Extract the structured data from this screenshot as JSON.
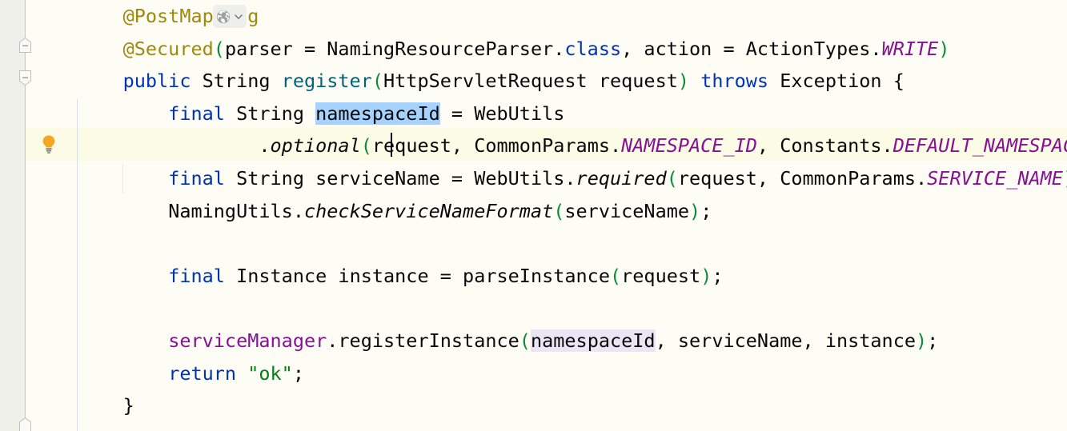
{
  "editor": {
    "language": "java",
    "theme": "IntelliJ Light",
    "colors": {
      "background": "#fdfdf6",
      "gutter_background": "#f0f0ea",
      "caret_row": "#fcfbe6",
      "selection": "#a6d2ff",
      "identifier_usage": "#eae6f5",
      "keyword": "#0033b3",
      "annotation": "#9e880d",
      "static_field": "#871094",
      "field": "#871094",
      "method_declaration": "#00627a",
      "string": "#067d17",
      "parentheses": "#0b8c3b",
      "default_text": "#080808",
      "caret": "#000000",
      "indent_guide": "#d7e0e8",
      "fold_line": "#c9c9c4",
      "bulb_accent": "#f5a623"
    },
    "gutter": {
      "icons": [
        {
          "name": "intention-bulb-icon",
          "label": "Show Context Actions",
          "line": 4
        },
        {
          "name": "fold-marker-collapsed-icon",
          "label": "Collapse annotation",
          "line": 2
        },
        {
          "name": "fold-marker-expanded-icon",
          "label": "Collapse method body",
          "line": 3
        },
        {
          "name": "fold-marker-end-icon",
          "label": "Method body end",
          "line": 13
        }
      ]
    },
    "inlay_hint": {
      "name": "url-mapping-inlay",
      "globe_icon": "globe-icon",
      "chevron_icon": "chevron-down-icon",
      "tooltip": "Open in browser / URL mappings"
    },
    "caret": {
      "line": 4,
      "visible": true
    },
    "selection": {
      "text": "namespaceId",
      "line": 4
    },
    "usage_highlight": {
      "text": "namespaceId",
      "line": 11
    },
    "lines": [
      {
        "n": 1,
        "indent": 4,
        "tokens": [
          {
            "t": "@PostMapping",
            "c": "anno"
          }
        ]
      },
      {
        "n": 2,
        "indent": 4,
        "tokens": [
          {
            "t": "@Secured",
            "c": "anno"
          },
          {
            "t": "(",
            "c": "paren"
          },
          {
            "t": "parser = NamingResourceParser.",
            "c": "ident"
          },
          {
            "t": "class",
            "c": "kw"
          },
          {
            "t": ", action = ActionTypes.",
            "c": "ident"
          },
          {
            "t": "WRITE",
            "c": "sfield"
          },
          {
            "t": ")",
            "c": "paren"
          }
        ]
      },
      {
        "n": 3,
        "indent": 4,
        "tokens": [
          {
            "t": "public",
            "c": "kw"
          },
          {
            "t": " String ",
            "c": "ident"
          },
          {
            "t": "register",
            "c": "method"
          },
          {
            "t": "(",
            "c": "paren"
          },
          {
            "t": "HttpServletRequest request",
            "c": "ident"
          },
          {
            "t": ")",
            "c": "paren"
          },
          {
            "t": " ",
            "c": "ident"
          },
          {
            "t": "throws",
            "c": "kw"
          },
          {
            "t": " Exception {",
            "c": "ident"
          }
        ]
      },
      {
        "n": 4,
        "indent": 8,
        "tokens": [
          {
            "t": "final",
            "c": "kw"
          },
          {
            "t": " String ",
            "c": "ident"
          },
          {
            "t": "namespaceId",
            "c": "ident",
            "sel": true
          },
          {
            "t": " = WebUtils",
            "c": "ident"
          }
        ]
      },
      {
        "n": 5,
        "indent": 16,
        "tokens": [
          {
            "t": ".",
            "c": "punc"
          },
          {
            "t": "optional",
            "c": "smethod"
          },
          {
            "t": "(",
            "c": "paren"
          },
          {
            "t": "request, CommonParams.",
            "c": "ident"
          },
          {
            "t": "NAMESPACE_ID",
            "c": "sfield"
          },
          {
            "t": ", Constants.",
            "c": "ident"
          },
          {
            "t": "DEFAULT_NAMESPACE_ID",
            "c": "sfield"
          },
          {
            "t": ")",
            "c": "paren"
          },
          {
            "t": ";",
            "c": "punc"
          }
        ]
      },
      {
        "n": 6,
        "indent": 8,
        "tokens": [
          {
            "t": "final",
            "c": "kw"
          },
          {
            "t": " String serviceName = WebUtils.",
            "c": "ident"
          },
          {
            "t": "required",
            "c": "smethod"
          },
          {
            "t": "(",
            "c": "paren"
          },
          {
            "t": "request, CommonParams.",
            "c": "ident"
          },
          {
            "t": "SERVICE_NAME",
            "c": "sfield"
          },
          {
            "t": ")",
            "c": "paren"
          },
          {
            "t": ";",
            "c": "punc"
          }
        ]
      },
      {
        "n": 7,
        "indent": 8,
        "tokens": [
          {
            "t": "NamingUtils.",
            "c": "ident"
          },
          {
            "t": "checkServiceNameFormat",
            "c": "smethod"
          },
          {
            "t": "(",
            "c": "paren"
          },
          {
            "t": "serviceName",
            "c": "ident"
          },
          {
            "t": ")",
            "c": "paren"
          },
          {
            "t": ";",
            "c": "punc"
          }
        ]
      },
      {
        "n": 8,
        "indent": 0,
        "tokens": []
      },
      {
        "n": 9,
        "indent": 8,
        "tokens": [
          {
            "t": "final",
            "c": "kw"
          },
          {
            "t": " Instance instance = parseInstance",
            "c": "ident"
          },
          {
            "t": "(",
            "c": "paren"
          },
          {
            "t": "request",
            "c": "ident"
          },
          {
            "t": ")",
            "c": "paren"
          },
          {
            "t": ";",
            "c": "punc"
          }
        ]
      },
      {
        "n": 10,
        "indent": 0,
        "tokens": []
      },
      {
        "n": 11,
        "indent": 8,
        "tokens": [
          {
            "t": "serviceManager",
            "c": "field"
          },
          {
            "t": ".registerInstance",
            "c": "ident"
          },
          {
            "t": "(",
            "c": "paren"
          },
          {
            "t": "namespaceId",
            "c": "ident",
            "usage": true
          },
          {
            "t": ", serviceName, instance",
            "c": "ident"
          },
          {
            "t": ")",
            "c": "paren"
          },
          {
            "t": ";",
            "c": "punc"
          }
        ]
      },
      {
        "n": 12,
        "indent": 8,
        "tokens": [
          {
            "t": "return",
            "c": "kw"
          },
          {
            "t": " ",
            "c": "ident"
          },
          {
            "t": "\"ok\"",
            "c": "str"
          },
          {
            "t": ";",
            "c": "punc"
          }
        ]
      },
      {
        "n": 13,
        "indent": 4,
        "tokens": [
          {
            "t": "}",
            "c": "ident"
          }
        ]
      }
    ]
  }
}
